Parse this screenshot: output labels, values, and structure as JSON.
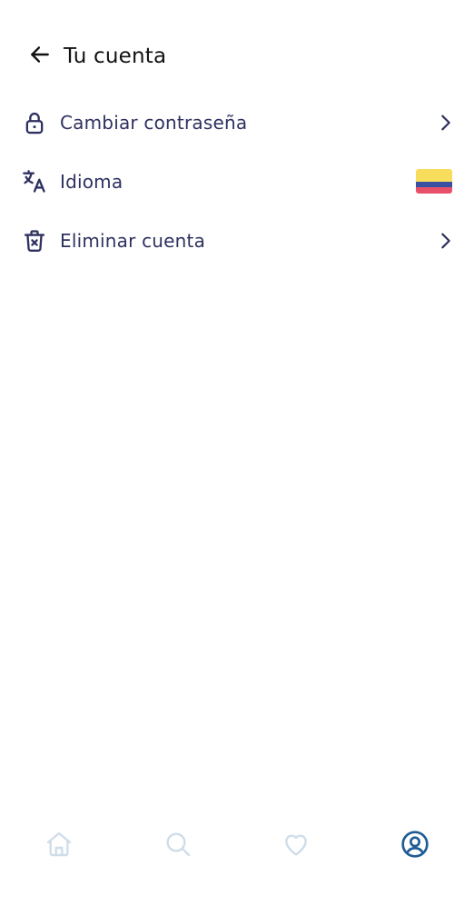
{
  "header": {
    "title": "Tu cuenta",
    "back_icon": "arrow-left-icon"
  },
  "menu": {
    "items": [
      {
        "label": "Cambiar contraseña",
        "icon": "lock-icon",
        "trailing": "chevron-right-icon"
      },
      {
        "label": "Idioma",
        "icon": "translate-icon",
        "trailing": "colombia-flag"
      },
      {
        "label": "Eliminar cuenta",
        "icon": "trash-icon",
        "trailing": "chevron-right-icon"
      }
    ]
  },
  "bottom_nav": {
    "items": [
      {
        "icon": "home-icon",
        "active": false
      },
      {
        "icon": "search-icon",
        "active": false
      },
      {
        "icon": "heart-icon",
        "active": false
      },
      {
        "icon": "user-circle-icon",
        "active": true
      }
    ],
    "active_color": "#1f5c94",
    "inactive_color": "#cfdde9"
  },
  "colors": {
    "text_primary": "#2f3160",
    "title": "#111111",
    "flag_yellow": "#f8dc5b",
    "flag_blue": "#3a50a0",
    "flag_red": "#e8506a"
  }
}
